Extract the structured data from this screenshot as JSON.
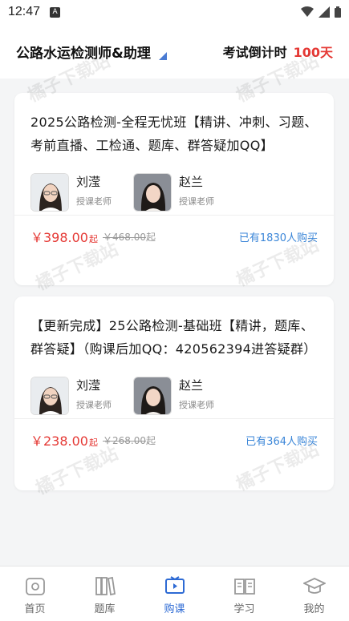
{
  "status": {
    "time": "12:47",
    "notif_icon": "A"
  },
  "header": {
    "title": "公路水运检测师&助理",
    "countdown_label": "考试倒计时",
    "countdown_value": "100天"
  },
  "watermark_text": "橘子下载站",
  "courses": [
    {
      "title": "2025公路检测-全程无忧班【精讲、冲刺、习题、考前直播、工检通、题库、群答疑加QQ】",
      "teachers": [
        {
          "name": "刘滢",
          "role": "授课老师"
        },
        {
          "name": "赵兰",
          "role": "授课老师"
        }
      ],
      "price": "￥398.00",
      "price_suffix": "起",
      "original_price": "￥468.00",
      "original_suffix": "起",
      "buyers": "已有1830人购买"
    },
    {
      "title": "【更新完成】25公路检测-基础班【精讲，题库、群答疑】（购课后加QQ：420562394进答疑群）",
      "teachers": [
        {
          "name": "刘滢",
          "role": "授课老师"
        },
        {
          "name": "赵兰",
          "role": "授课老师"
        }
      ],
      "price": "￥238.00",
      "price_suffix": "起",
      "original_price": "￥268.00",
      "original_suffix": "起",
      "buyers": "已有364人购买"
    }
  ],
  "tabs": [
    {
      "label": "首页",
      "icon": "home-icon"
    },
    {
      "label": "题库",
      "icon": "books-icon"
    },
    {
      "label": "购课",
      "icon": "video-icon",
      "active": true
    },
    {
      "label": "学习",
      "icon": "book-open-icon"
    },
    {
      "label": "我的",
      "icon": "graduation-cap-icon"
    }
  ],
  "colors": {
    "accent": "#2d6ad4",
    "price": "#e53935",
    "buyers": "#3b86d8"
  }
}
